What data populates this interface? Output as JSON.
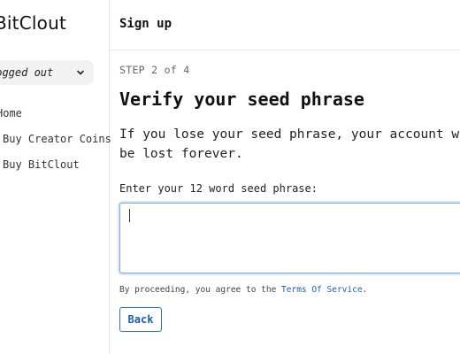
{
  "sidebar": {
    "logo_text": "BitClout",
    "account_selector": {
      "label": "Logged out",
      "icon": "chevron-down-icon"
    },
    "section_heading": "Home",
    "items": [
      {
        "label": "Buy Creator Coins"
      },
      {
        "label": "Buy BitClout"
      }
    ]
  },
  "header": {
    "title": "Sign up"
  },
  "main": {
    "step_label": "STEP 2 of 4",
    "heading": "Verify your seed phrase",
    "description": "If you lose your seed phrase, your account will be lost forever.",
    "field_label": "Enter your 12 word seed phrase:",
    "seed_input_value": "",
    "agreement_prefix": "By proceeding, you agree to the ",
    "agreement_link": "Terms Of Service",
    "agreement_suffix": ".",
    "back_label": "Back"
  },
  "colors": {
    "link": "#1a5fb4",
    "input_focus_border": "#7fa9dc",
    "pill_background": "#f2f2f2"
  }
}
